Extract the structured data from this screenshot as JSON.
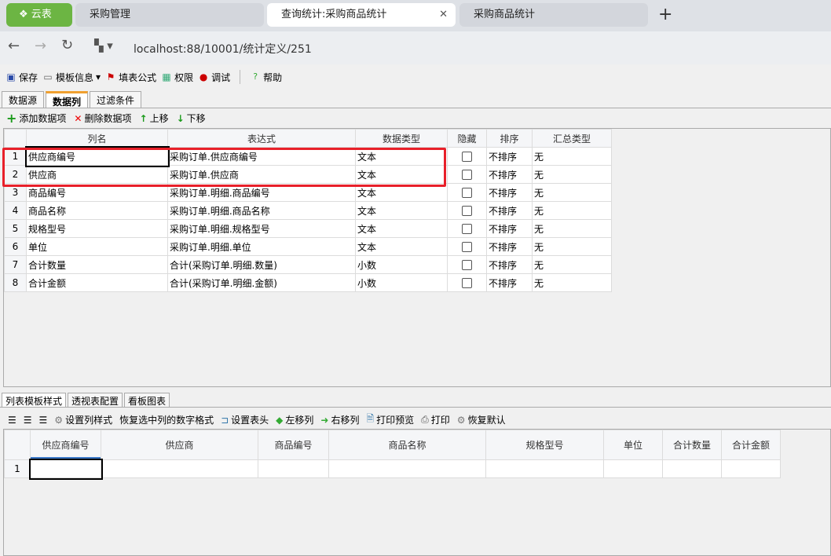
{
  "browser": {
    "tabs": [
      {
        "label": "云表"
      },
      {
        "label": "采购管理"
      },
      {
        "label": "查询统计:采购商品统计"
      },
      {
        "label": "采购商品统计"
      }
    ],
    "url": "localhost:88/10001/统计定义/251"
  },
  "toolbar": {
    "save": "保存",
    "template_info": "模板信息",
    "fill_formula": "填表公式",
    "permission": "权限",
    "debug": "调试",
    "help": "帮助"
  },
  "top_tabs": [
    "数据源",
    "数据列",
    "过滤条件"
  ],
  "data_toolbar": {
    "add": "添加数据项",
    "delete": "删除数据项",
    "up": "上移",
    "down": "下移"
  },
  "grid": {
    "headers": [
      "列名",
      "表达式",
      "数据类型",
      "隐藏",
      "排序",
      "汇总类型"
    ],
    "rows": [
      {
        "n": "1",
        "name": "供应商编号",
        "expr": "采购订单.供应商编号",
        "type": "文本",
        "hidden": false,
        "sort": "不排序",
        "agg": "无"
      },
      {
        "n": "2",
        "name": "供应商",
        "expr": "采购订单.供应商",
        "type": "文本",
        "hidden": false,
        "sort": "不排序",
        "agg": "无"
      },
      {
        "n": "3",
        "name": "商品编号",
        "expr": "采购订单.明细.商品编号",
        "type": "文本",
        "hidden": false,
        "sort": "不排序",
        "agg": "无"
      },
      {
        "n": "4",
        "name": "商品名称",
        "expr": "采购订单.明细.商品名称",
        "type": "文本",
        "hidden": false,
        "sort": "不排序",
        "agg": "无"
      },
      {
        "n": "5",
        "name": "规格型号",
        "expr": "采购订单.明细.规格型号",
        "type": "文本",
        "hidden": false,
        "sort": "不排序",
        "agg": "无"
      },
      {
        "n": "6",
        "name": "单位",
        "expr": "采购订单.明细.单位",
        "type": "文本",
        "hidden": false,
        "sort": "不排序",
        "agg": "无"
      },
      {
        "n": "7",
        "name": "合计数量",
        "expr": "合计(采购订单.明细.数量)",
        "type": "小数",
        "hidden": false,
        "sort": "不排序",
        "agg": "无"
      },
      {
        "n": "8",
        "name": "合计金额",
        "expr": "合计(采购订单.明细.金额)",
        "type": "小数",
        "hidden": false,
        "sort": "不排序",
        "agg": "无"
      }
    ]
  },
  "bottom_tabs": [
    "列表模板样式",
    "透视表配置",
    "看板图表"
  ],
  "bottom_toolbar": {
    "set_col_style": "设置列样式",
    "restore_num": "恢复选中列的数字格式",
    "set_header": "设置表头",
    "move_left": "左移列",
    "move_right": "右移列",
    "print_preview": "打印预览",
    "print": "打印",
    "restore_default": "恢复默认"
  },
  "preview": {
    "headers": [
      "供应商编号",
      "供应商",
      "商品编号",
      "商品名称",
      "规格型号",
      "单位",
      "合计数量",
      "合计金额"
    ],
    "row_num": "1"
  }
}
